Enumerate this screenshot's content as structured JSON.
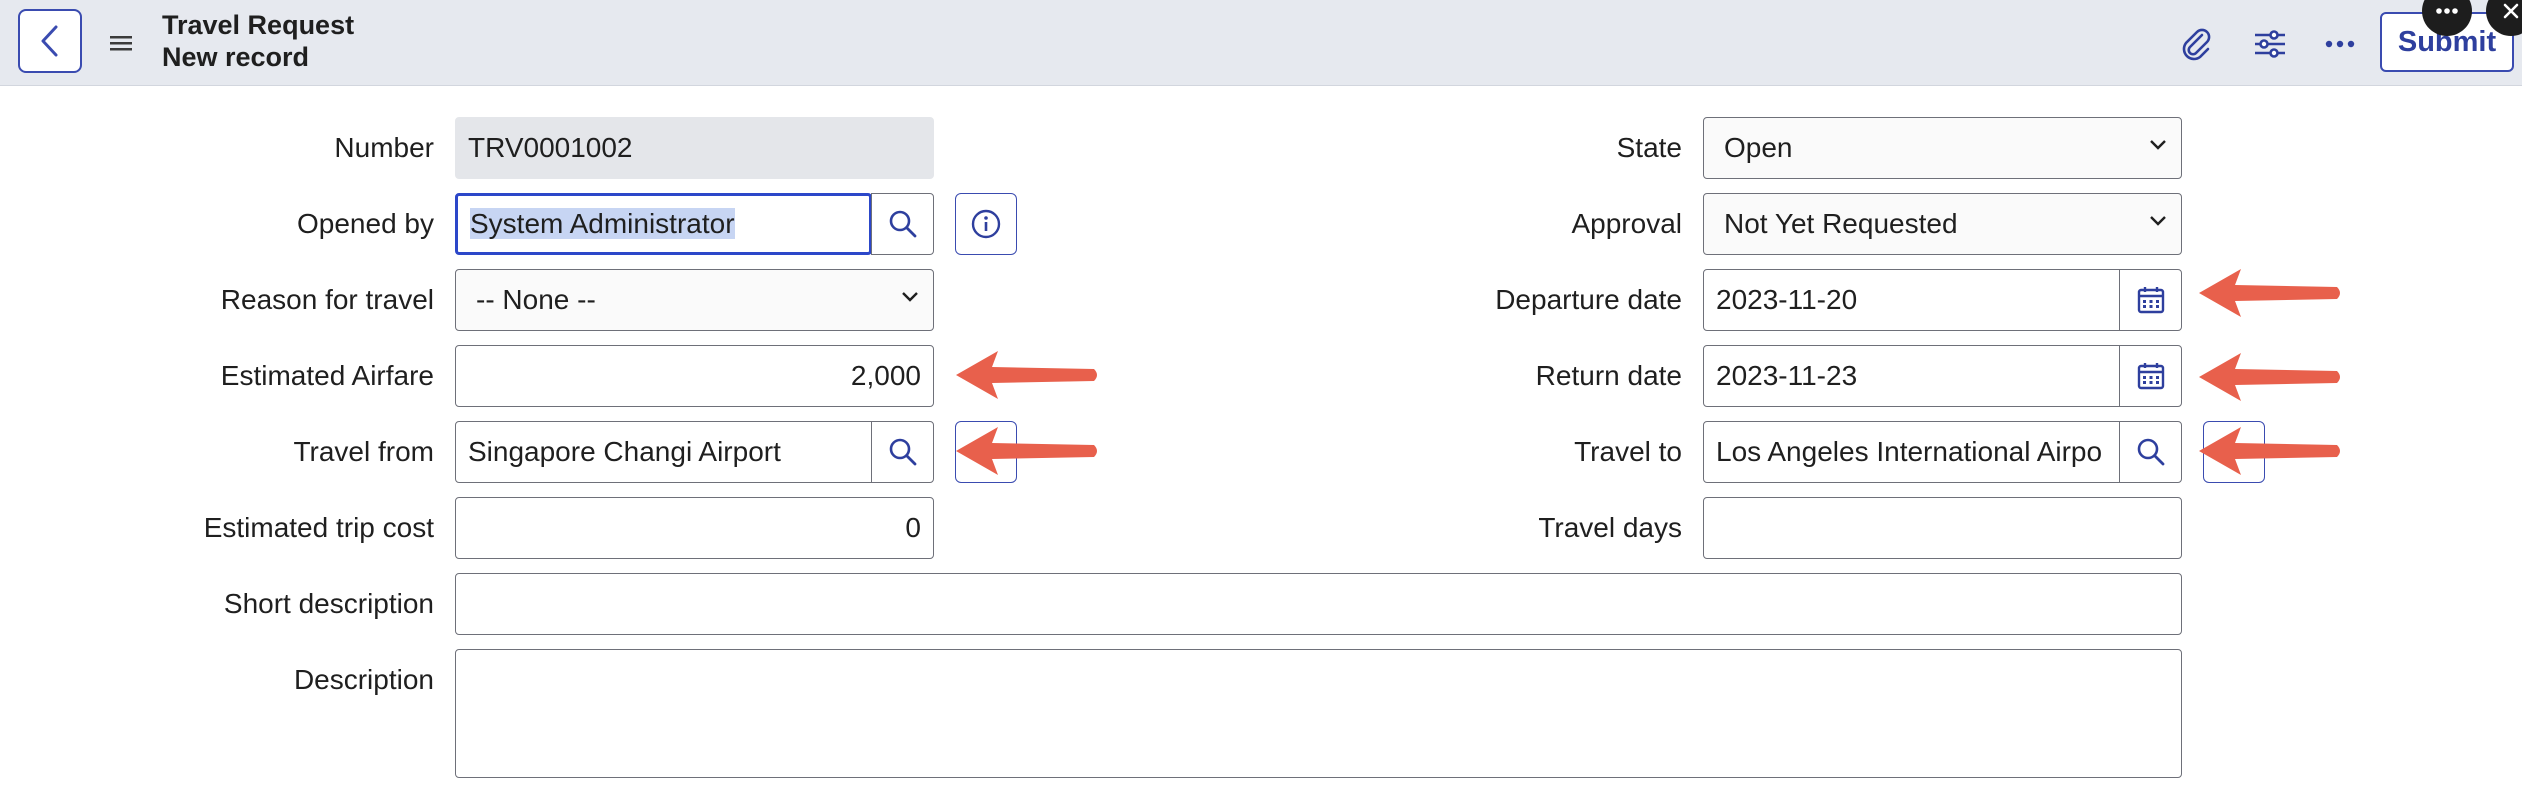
{
  "header": {
    "title": "Travel Request",
    "subtitle": "New record",
    "submit_label": "Submit",
    "icons": [
      "back-icon",
      "menu-icon",
      "attachment-icon",
      "settings-sliders-icon",
      "more-icon",
      "more-dots-icon",
      "close-icon"
    ]
  },
  "form": {
    "left": {
      "number": {
        "label": "Number",
        "value": "TRV0001002"
      },
      "opened_by": {
        "label": "Opened by",
        "value": "System Administrator"
      },
      "reason": {
        "label": "Reason for travel",
        "value": "-- None --"
      },
      "airfare": {
        "label": "Estimated Airfare",
        "value": "2,000"
      },
      "travel_from": {
        "label": "Travel from",
        "value": "Singapore Changi Airport"
      },
      "trip_cost": {
        "label": "Estimated trip cost",
        "value": "0"
      }
    },
    "right": {
      "state": {
        "label": "State",
        "value": "Open"
      },
      "approval": {
        "label": "Approval",
        "value": "Not Yet Requested"
      },
      "departure": {
        "label": "Departure date",
        "value": "2023-11-20"
      },
      "return": {
        "label": "Return date",
        "value": "2023-11-23"
      },
      "travel_to": {
        "label": "Travel to",
        "value": "Los Angeles International Airpo"
      },
      "travel_days": {
        "label": "Travel days",
        "value": ""
      }
    },
    "short_description": {
      "label": "Short description",
      "value": ""
    },
    "description": {
      "label": "Description",
      "value": ""
    }
  },
  "colors": {
    "accent": "#3a4bb0",
    "arrow": "#e8604c",
    "header_bg": "#e6e9ef"
  }
}
